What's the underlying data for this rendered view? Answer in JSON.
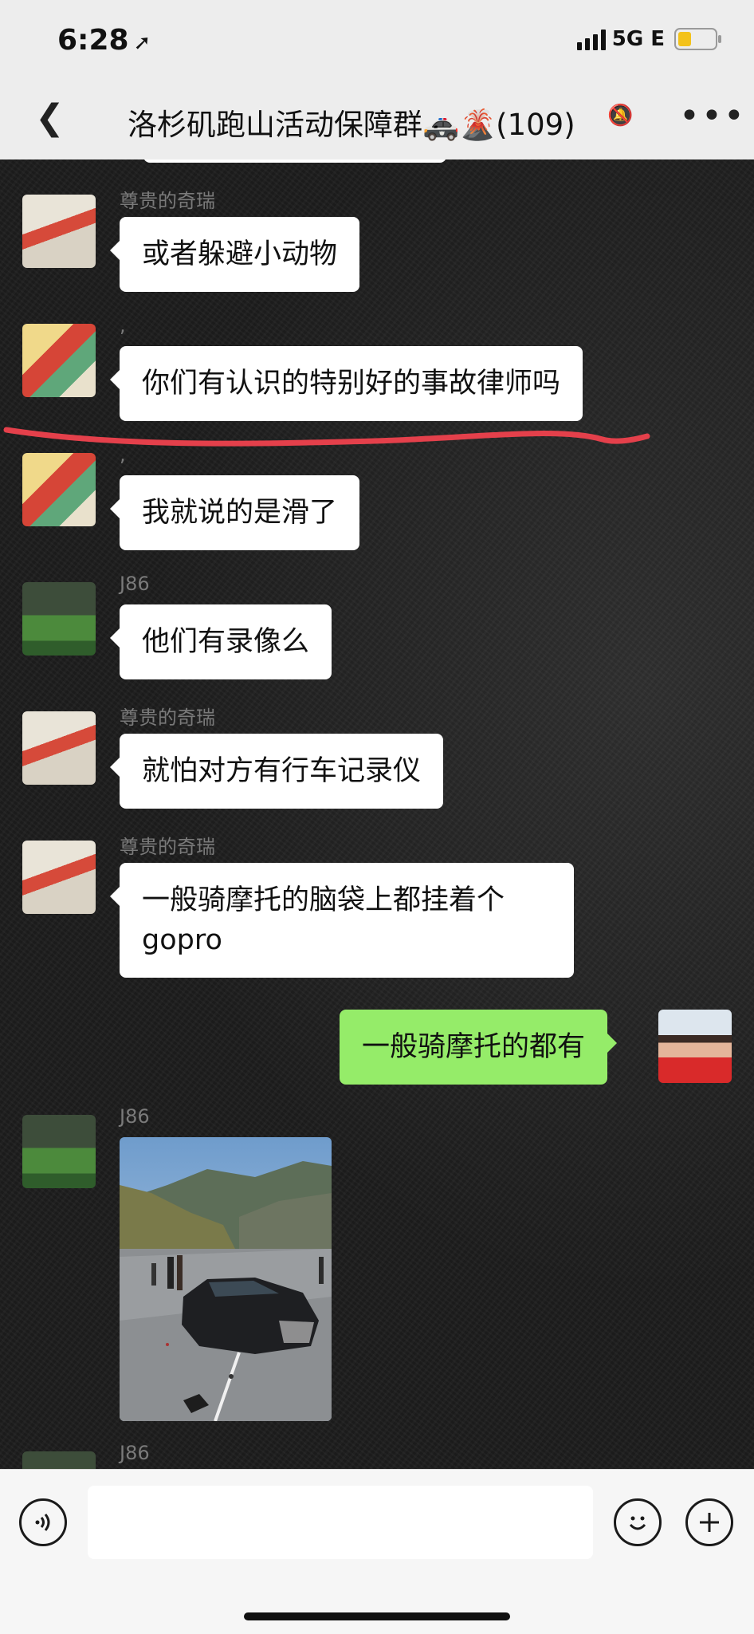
{
  "status_bar": {
    "time": "6:28",
    "network": "5G E"
  },
  "nav": {
    "title": "洛杉矶跑山活动保障群🚓🌋(109)"
  },
  "messages": [
    {
      "sender": "尊贵的奇瑞",
      "text": "或者躲避小动物",
      "side": "left"
    },
    {
      "sender": ",",
      "text": "你们有认识的特别好的事故律师吗",
      "side": "left"
    },
    {
      "sender": ",",
      "text": "我就说的是滑了",
      "side": "left"
    },
    {
      "sender": "J86",
      "text": "他们有录像么",
      "side": "left"
    },
    {
      "sender": "尊贵的奇瑞",
      "text": "就怕对方有行车记录仪",
      "side": "left"
    },
    {
      "sender": "尊贵的奇瑞",
      "text": "一般骑摩托的脑袋上都挂着个gopro",
      "side": "left"
    },
    {
      "sender": "",
      "text": "一般骑摩托的都有",
      "side": "right"
    },
    {
      "sender": "J86",
      "text": "",
      "side": "left",
      "type": "image"
    },
    {
      "sender": "J86",
      "text": "",
      "side": "left"
    }
  ],
  "colors": {
    "highlight_line": "#e4404b",
    "self_bubble": "#95ec69"
  }
}
